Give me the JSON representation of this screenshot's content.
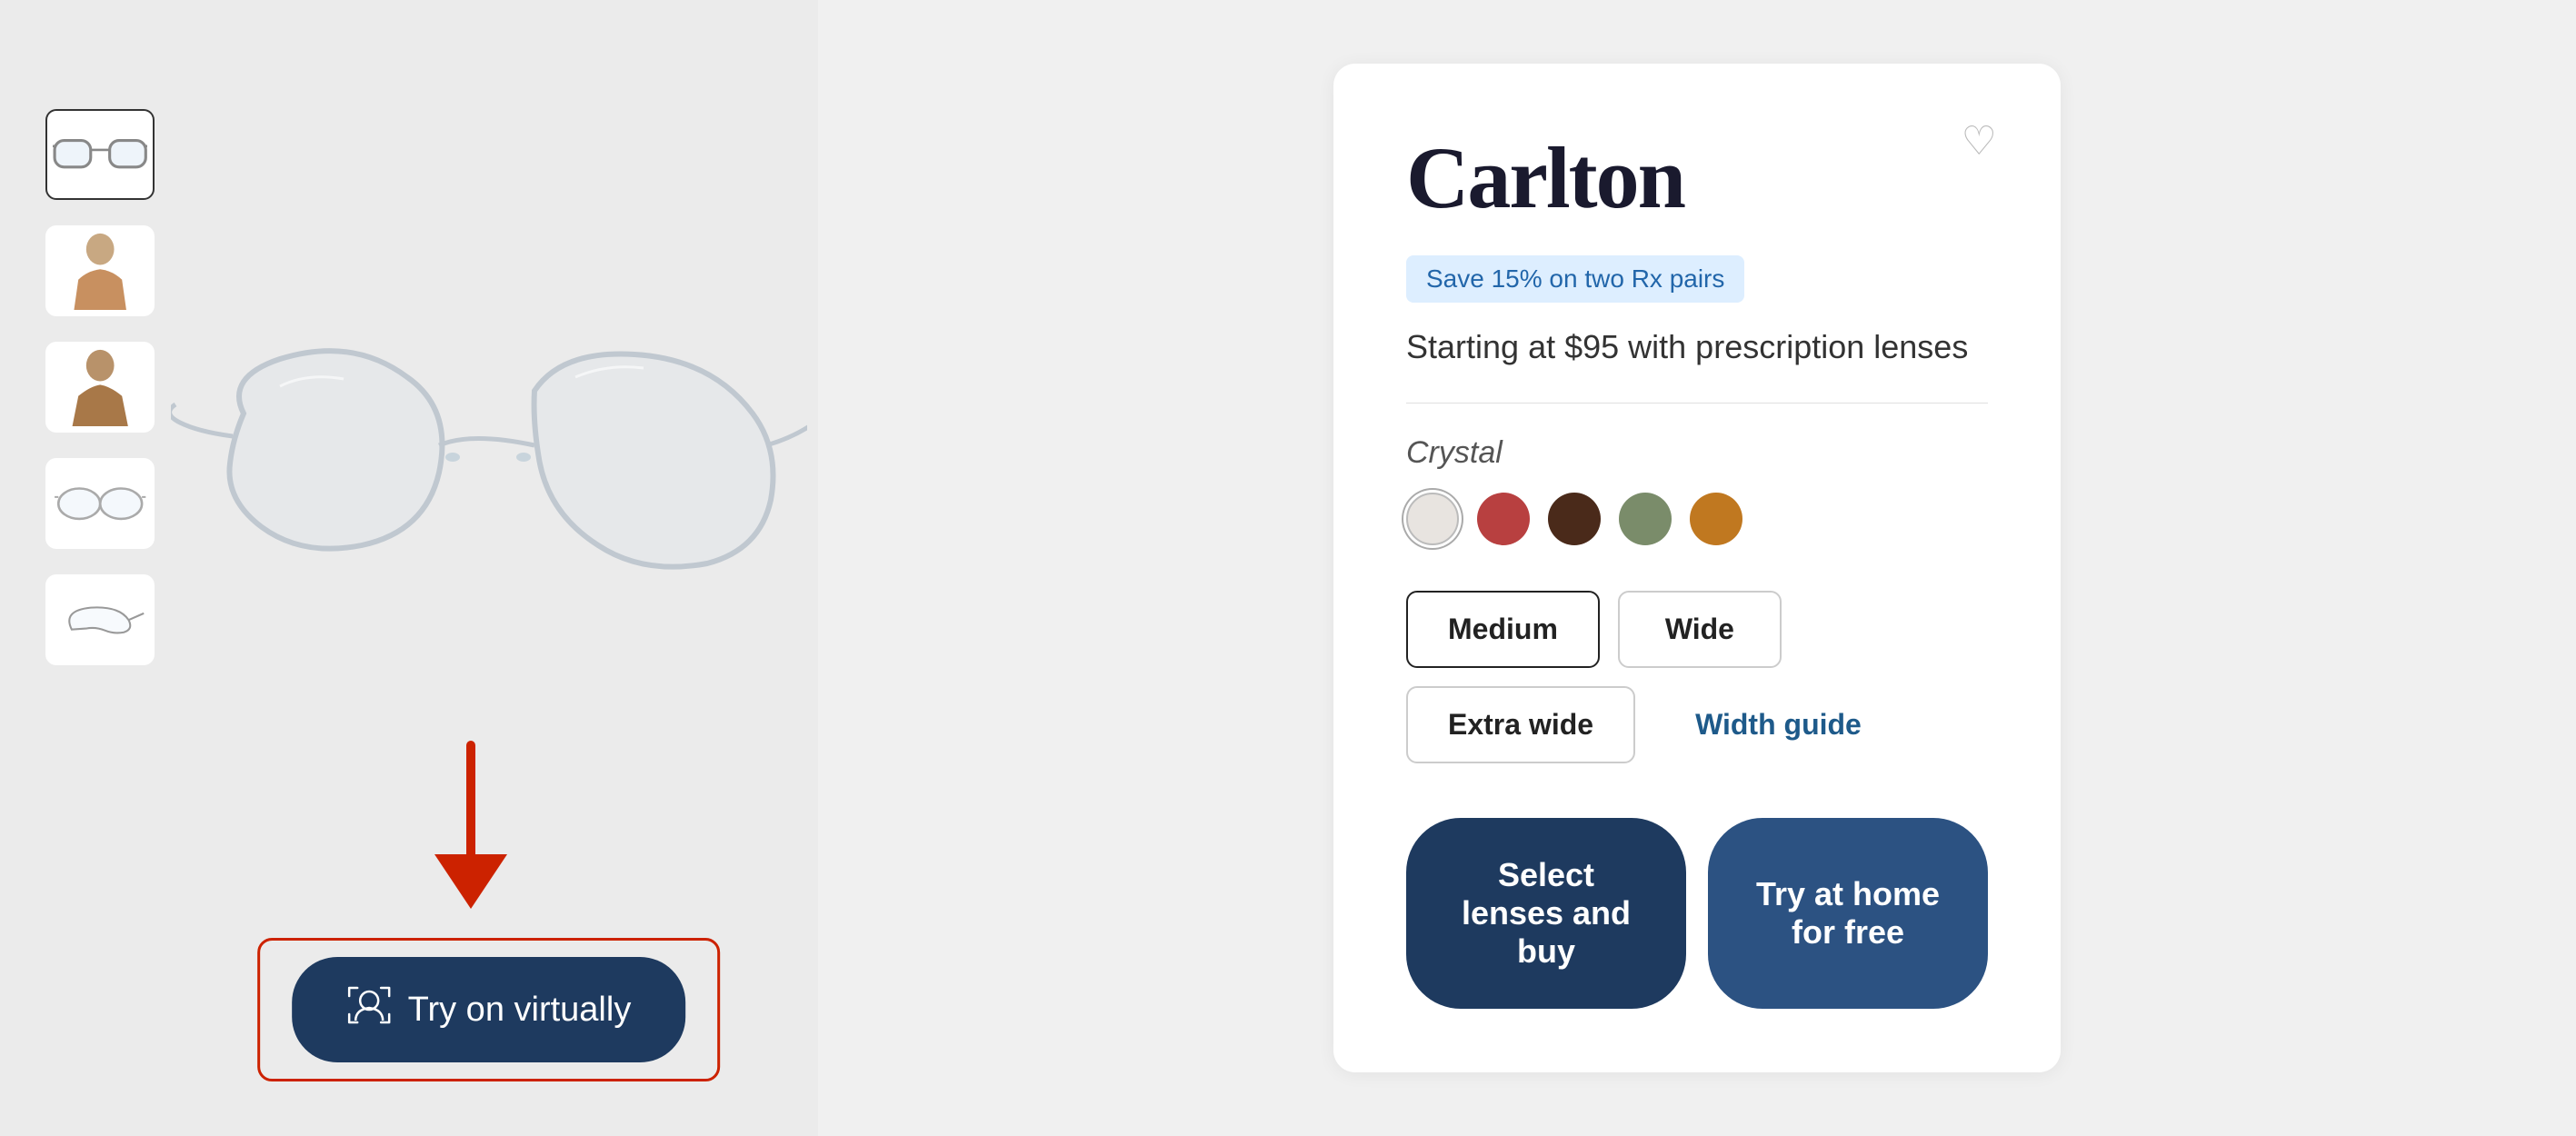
{
  "product": {
    "title": "Carlton",
    "promo_badge": "Save 15% on two Rx pairs",
    "price_text": "Starting at $95 with prescription lenses",
    "color_label": "Crystal",
    "wishlist_icon": "♡",
    "colors": [
      {
        "name": "Crystal",
        "hex": "#e8e8e8",
        "selected": true
      },
      {
        "name": "Red",
        "hex": "#b84040"
      },
      {
        "name": "Dark Brown",
        "hex": "#4a2a1a"
      },
      {
        "name": "Sage",
        "hex": "#7a8c6a"
      },
      {
        "name": "Amber",
        "hex": "#c07820"
      }
    ],
    "sizes": [
      {
        "label": "Medium",
        "active": true,
        "link": false
      },
      {
        "label": "Wide",
        "active": false,
        "link": false
      },
      {
        "label": "Extra wide",
        "active": false,
        "link": false
      },
      {
        "label": "Width guide",
        "active": false,
        "link": true
      }
    ],
    "buttons": {
      "select_lenses": "Select lenses and buy",
      "try_at_home": "Try at home for free"
    }
  },
  "thumbnails": [
    {
      "type": "glasses",
      "label": "Product front view"
    },
    {
      "type": "person_female",
      "label": "Model female"
    },
    {
      "type": "person_male",
      "label": "Model male"
    },
    {
      "type": "glasses_alt",
      "label": "Product alt view"
    },
    {
      "type": "glasses_side",
      "label": "Product side view"
    }
  ],
  "try_on": {
    "button_label": "Try on virtually",
    "icon": "👤"
  },
  "colors": {
    "primary_dark": "#1e3a5f",
    "primary_medium": "#2c5282",
    "accent_red": "#cc2200",
    "badge_bg": "#ddeeff",
    "badge_text": "#2266aa"
  }
}
